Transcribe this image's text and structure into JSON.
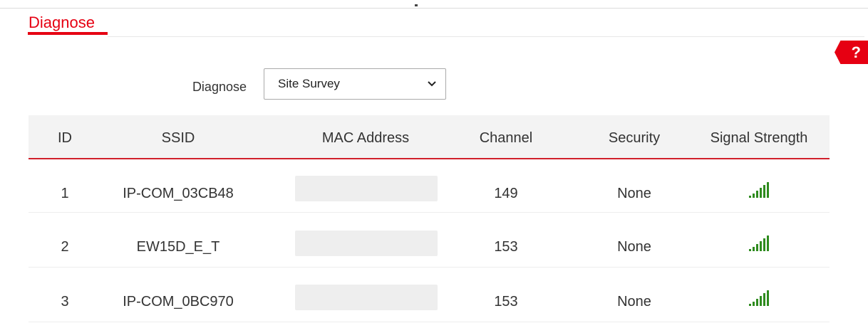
{
  "page": {
    "title": "Diagnose",
    "help_label": "?"
  },
  "form": {
    "diagnose_label": "Diagnose",
    "diagnose_select_value": "Site Survey"
  },
  "table": {
    "headers": [
      "ID",
      "SSID",
      "MAC Address",
      "Channel",
      "Security",
      "Signal Strength"
    ],
    "rows": [
      {
        "id": "1",
        "ssid": "IP-COM_03CB48",
        "mac": "",
        "channel": "149",
        "security": "None",
        "signal": "signal-strength-icon"
      },
      {
        "id": "2",
        "ssid": "EW15D_E_T",
        "mac": "",
        "channel": "153",
        "security": "None",
        "signal": "signal-strength-icon"
      },
      {
        "id": "3",
        "ssid": "IP-COM_0BC970",
        "mac": "",
        "channel": "153",
        "security": "None",
        "signal": "signal-strength-icon"
      }
    ]
  },
  "colors": {
    "accent": "#e60012",
    "signal": "#2e8b1e",
    "header_bg": "#f3f3f3"
  }
}
